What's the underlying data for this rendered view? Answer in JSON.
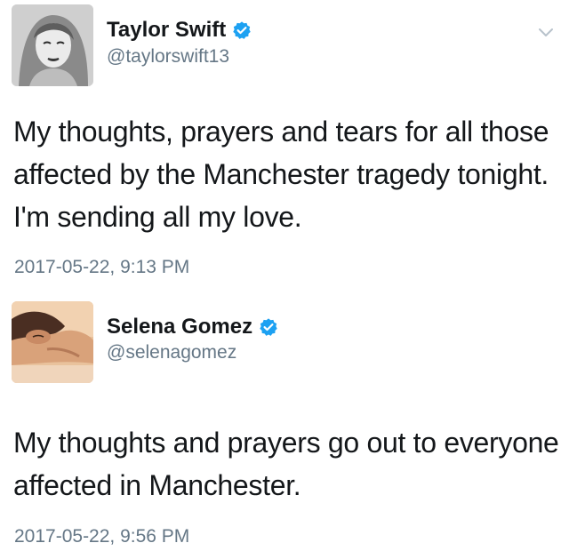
{
  "tweets": [
    {
      "name": "Taylor Swift",
      "handle": "@taylorswift13",
      "verified": true,
      "text": "My thoughts, prayers and tears for all those affected by the Manchester tragedy tonight. I'm sending all my love.",
      "timestamp": "2017-05-22, 9:13 PM"
    },
    {
      "name": "Selena Gomez",
      "handle": "@selenagomez",
      "verified": true,
      "text": "My thoughts and prayers go out to everyone affected in Manchester.",
      "timestamp": "2017-05-22, 9:56 PM"
    }
  ],
  "icons": {
    "verified": "verified-badge-icon",
    "menu": "chevron-down-icon"
  },
  "colors": {
    "verified_blue": "#1da1f2",
    "secondary_text": "#657786",
    "primary_text": "#14171a"
  }
}
